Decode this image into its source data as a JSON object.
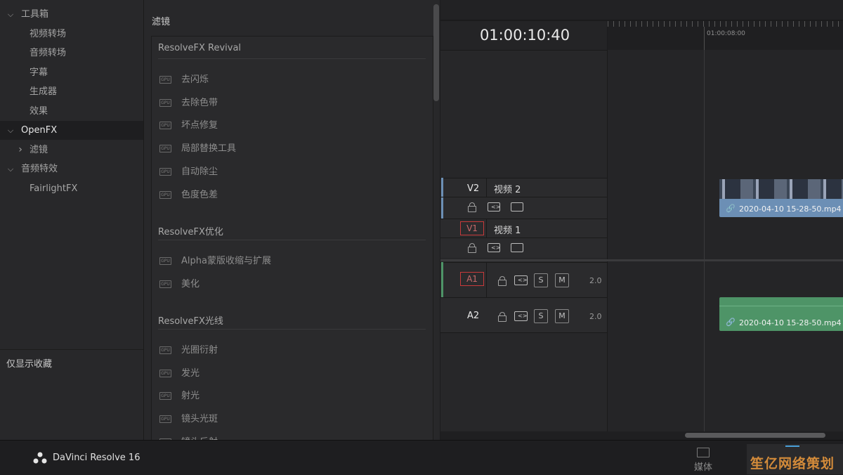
{
  "tree": {
    "items": [
      {
        "label": "工具箱",
        "chevron": "chevron-down-icon",
        "indent": 0,
        "selected": false
      },
      {
        "label": "视频转场",
        "chevron": "",
        "indent": 1,
        "selected": false
      },
      {
        "label": "音频转场",
        "chevron": "",
        "indent": 1,
        "selected": false
      },
      {
        "label": "字幕",
        "chevron": "",
        "indent": 1,
        "selected": false
      },
      {
        "label": "生成器",
        "chevron": "",
        "indent": 1,
        "selected": false
      },
      {
        "label": "效果",
        "chevron": "",
        "indent": 1,
        "selected": false
      },
      {
        "label": "OpenFX",
        "chevron": "chevron-down-icon",
        "indent": 0,
        "selected": true
      },
      {
        "label": "滤镜",
        "chevron": "chevron-right-icon",
        "indent": 1,
        "selected": false
      },
      {
        "label": "音频特效",
        "chevron": "chevron-down-icon",
        "indent": 0,
        "selected": false
      },
      {
        "label": "FairlightFX",
        "chevron": "",
        "indent": 1,
        "selected": false
      }
    ],
    "favorites_label": "仅显示收藏"
  },
  "fx_panel": {
    "title": "滤镜",
    "categories": [
      {
        "title": "ResolveFX Revival",
        "items": [
          "去闪烁",
          "去除色带",
          "坏点修复",
          "局部替换工具",
          "自动除尘",
          "色度色差"
        ]
      },
      {
        "title": "ResolveFX优化",
        "items": [
          "Alpha蒙版收缩与扩展",
          "美化"
        ]
      },
      {
        "title": "ResolveFX光线",
        "items": [
          "光圈衍射",
          "发光",
          "射光",
          "镜头光斑",
          "镜头反射"
        ]
      }
    ],
    "gpu_badge": "GPU"
  },
  "timeline": {
    "timecode": "01:00:10:40",
    "ruler_label": "01:00:08:00",
    "tracks": {
      "v2": {
        "id": "V2",
        "name": "视频 2"
      },
      "v1": {
        "id": "V1",
        "name": "视频 1"
      },
      "a1": {
        "id": "A1",
        "solo": "S",
        "mute": "M",
        "channels": "2.0"
      },
      "a2": {
        "id": "A2",
        "solo": "S",
        "mute": "M",
        "channels": "2.0"
      }
    },
    "video_clip": {
      "name": "2020-04-10 15-28-50.mp4",
      "color": "#6c8fb5"
    },
    "audio_clip": {
      "name": "2020-04-10 15-28-50.mp4",
      "color": "#4e9467"
    }
  },
  "bottombar": {
    "app_title": "DaVinci Resolve 16",
    "media_label": "媒体"
  },
  "watermark": {
    "text": "笙亿网络策划"
  }
}
